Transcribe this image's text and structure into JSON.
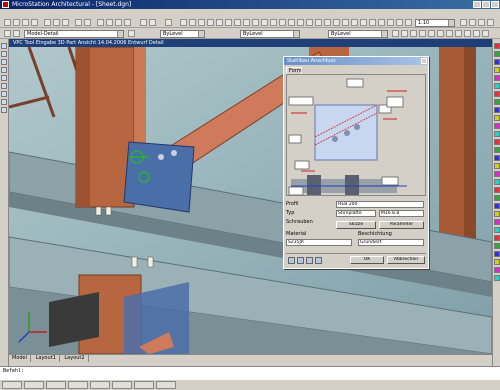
{
  "window": {
    "title": "MicroStation Architectural - [Sheet.dgn]"
  },
  "toolbar": {
    "layer_combo": "Model-Detail",
    "color_combo": "ByLevel",
    "style_combo": "ByLevel",
    "weight_combo": "ByLevel",
    "scale_combo": "1:10"
  },
  "document": {
    "title": "VPC Tool Eingabe 3D Part Ansicht 14.04.2006 Entwurf Detail"
  },
  "layout_tabs": [
    "Model",
    "Layout1",
    "Layout2"
  ],
  "command_line": {
    "text": "Befehl:"
  },
  "dialog": {
    "title": "Stahlbau Anschluss",
    "tab": "Form",
    "row1_label": "Profil",
    "row1_value": "HEB 200",
    "row2_label": "Typ",
    "row2_value": "Stirnplatte",
    "row3_label": "Schrauben",
    "row3_value": "M16 8.8",
    "button_sketch": "Skizze",
    "button_params": "Parameter",
    "material_label": "Material",
    "material_value": "S235JR",
    "finish_label": "Beschichtung",
    "finish_value": "Grundiert",
    "ok_label": "OK",
    "close_label": "Abbrechen"
  },
  "colors": {
    "steel_column": "#b8663f",
    "steel_beam": "#9fb3b8",
    "plate": "#4a6ea8",
    "viewport_bg": "#92b0b8",
    "dialog_highlight": "#c9d6f0"
  }
}
